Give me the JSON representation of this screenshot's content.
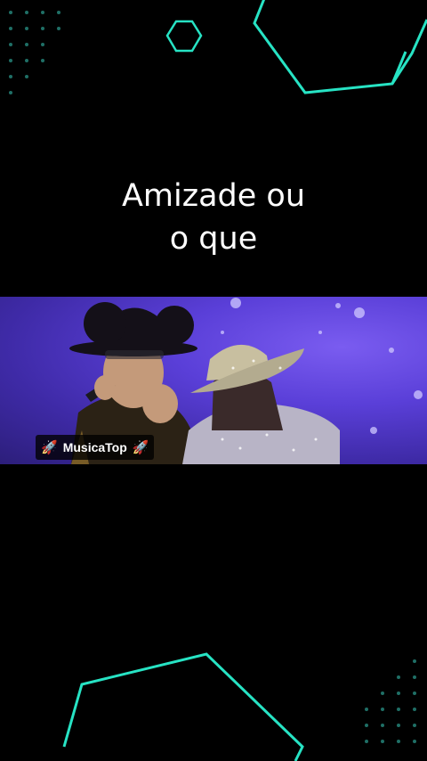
{
  "caption": {
    "line1": "Amizade ou",
    "line2": "o que"
  },
  "video": {
    "watermark_label": "MusicaTop",
    "watermark_icon": "rocket-icon"
  },
  "theme": {
    "background": "#000000",
    "accent": "#27e3c4",
    "video_bg": "#5a3fd8"
  }
}
